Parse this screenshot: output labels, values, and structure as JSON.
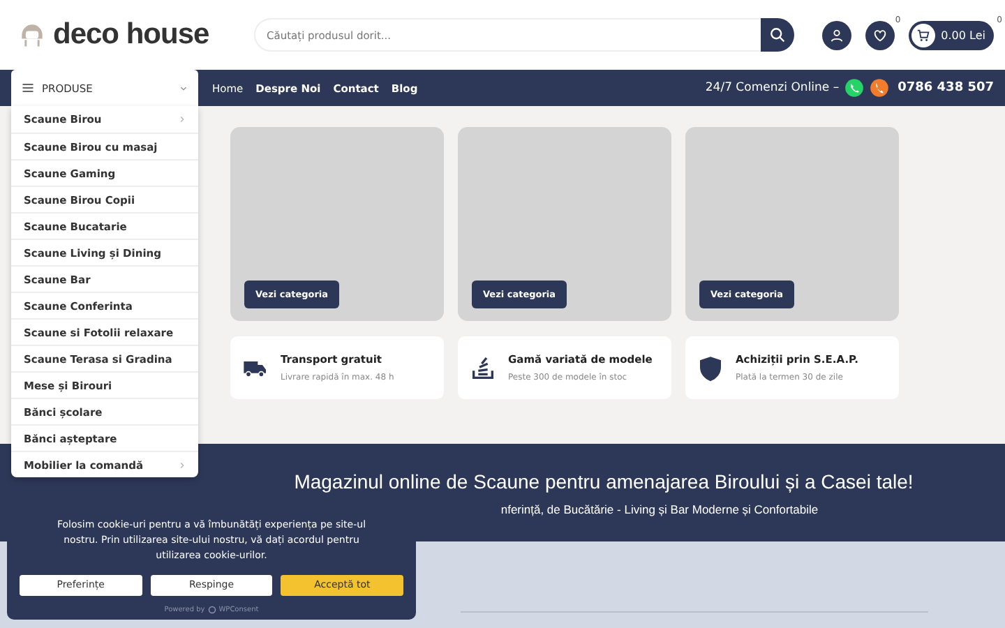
{
  "logo": {
    "text": "deco house"
  },
  "search": {
    "placeholder": "Căutați produsul dorit..."
  },
  "header_actions": {
    "wishlist_count": "0",
    "cart_count": "0",
    "cart_total": "0.00 Lei"
  },
  "nav": {
    "menu_label": "PRODUSE",
    "links": [
      "Home",
      "Despre Noi",
      "Contact",
      "Blog"
    ],
    "contact_text": "24/7 Comenzi Online –",
    "phone": "0786 438 507"
  },
  "categories_menu": [
    {
      "label": "Scaune Birou",
      "has_submenu": true
    },
    {
      "label": "Scaune Birou cu masaj",
      "has_submenu": false
    },
    {
      "label": "Scaune Gaming",
      "has_submenu": false
    },
    {
      "label": "Scaune Birou Copii",
      "has_submenu": false
    },
    {
      "label": "Scaune Bucatarie",
      "has_submenu": false
    },
    {
      "label": "Scaune Living și Dining",
      "has_submenu": false
    },
    {
      "label": "Scaune Bar",
      "has_submenu": false
    },
    {
      "label": "Scaune Conferinta",
      "has_submenu": false
    },
    {
      "label": "Scaune si Fotolii relaxare",
      "has_submenu": false
    },
    {
      "label": "Scaune Terasa si Gradina",
      "has_submenu": false
    },
    {
      "label": "Mese și Birouri",
      "has_submenu": false
    },
    {
      "label": "Bănci școlare",
      "has_submenu": false
    },
    {
      "label": "Bănci așteptare",
      "has_submenu": false
    },
    {
      "label": "Mobilier la comandă",
      "has_submenu": true
    }
  ],
  "category_cards": [
    {
      "button": "Vezi categoria"
    },
    {
      "button": "Vezi categoria"
    },
    {
      "button": "Vezi categoria"
    }
  ],
  "features": [
    {
      "kind": "truck",
      "title": "Transport gratuit",
      "subtitle": "Livrare rapidă în max. 48 h"
    },
    {
      "kind": "stack",
      "title": "Gamă variată de modele",
      "subtitle": "Peste 300 de modele în stoc"
    },
    {
      "kind": "shield",
      "title": "Achiziții prin S.E.A.P.",
      "subtitle": "Plată la termen 30 de zile"
    }
  ],
  "banner": {
    "title": "Magazinul online de Scaune pentru amenajarea Biroului și a Casei tale!",
    "subtitle": "nferință, de Bucătărie - Living și Bar Moderne și Confortabile"
  },
  "cookie_notice": {
    "text": "Folosim cookie-uri pentru a vă îmbunătăți experiența pe site-ul nostru. Prin utilizarea site-ului nostru, vă dați acordul pentru utilizarea cookie-urilor.",
    "buttons": [
      {
        "label": "Preferințe",
        "kind": "plain"
      },
      {
        "label": "Respinge",
        "kind": "plain"
      },
      {
        "label": "Acceptă tot",
        "kind": "primary"
      }
    ],
    "powered_by": "Powered by",
    "brand": "WPConsent"
  }
}
